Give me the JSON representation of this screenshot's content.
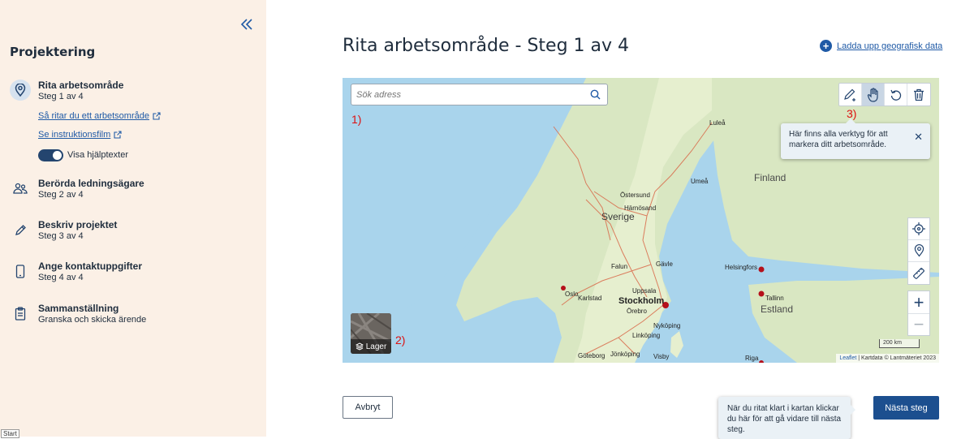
{
  "sidebar": {
    "title": "Projektering",
    "steps": [
      {
        "title": "Rita arbetsområde",
        "sub": "Steg 1 av 4",
        "icon": "location-pin-icon"
      },
      {
        "title": "Berörda ledningsägare",
        "sub": "Steg 2 av 4",
        "icon": "people-icon"
      },
      {
        "title": "Beskriv projektet",
        "sub": "Steg 3 av 4",
        "icon": "pencil-icon"
      },
      {
        "title": "Ange kontaktuppgifter",
        "sub": "Steg 4 av 4",
        "icon": "phone-icon"
      },
      {
        "title": "Sammanställning",
        "sub": "Granska och skicka ärende",
        "icon": "clipboard-icon"
      }
    ],
    "links": {
      "how_to": "Så ritar du ett arbetsområde",
      "video": "Se instruktionsfilm"
    },
    "toggle_label": "Visa hjälptexter",
    "toggle_on": true
  },
  "start_tag": "Start",
  "header": {
    "title": "Rita arbetsområde - Steg 1 av 4",
    "upload": "Ladda upp geografisk data"
  },
  "map": {
    "search_placeholder": "Sök adress",
    "annotations": [
      "1)",
      "2)",
      "3)"
    ],
    "tooltip": "Här finns alla verktyg för att markera ditt arbetsområde.",
    "layers_label": "Lager",
    "scale": "200 km",
    "attribution_link": "Leaflet",
    "attribution_text": " | Kartdata © Lantmäteriet 2023",
    "countries": {
      "sweden": "Sverige",
      "finland": "Finland",
      "estonia": "Estland"
    },
    "cities": {
      "lulea": "Luleå",
      "umea": "Umeå",
      "ostersund": "Östersund",
      "harnosand": "Härnösand",
      "falun": "Falun",
      "gavle": "Gävle",
      "helsingfors": "Helsingfors",
      "oslo": "Oslo",
      "karlstad": "Karlstad",
      "uppsala": "Uppsala",
      "stockholm": "Stockholm",
      "orebro": "Örebro",
      "tallinn": "Tallinn",
      "nykoping": "Nyköping",
      "linkoping": "Linköping",
      "goteborg": "Göteborg",
      "jonkoping": "Jönköping",
      "visby": "Visby",
      "riga": "Riga"
    }
  },
  "footer": {
    "cancel": "Avbryt",
    "next": "Nästa steg",
    "next_tip": "När du ritat klart i kartan klickar du här för att gå vidare till nästa steg."
  },
  "colors": {
    "accent": "#1c4f8f",
    "sidebar_bg": "#fbf0e6",
    "annotation": "#dd1111",
    "water": "#a9d4ec",
    "land": "#e6efcf"
  }
}
